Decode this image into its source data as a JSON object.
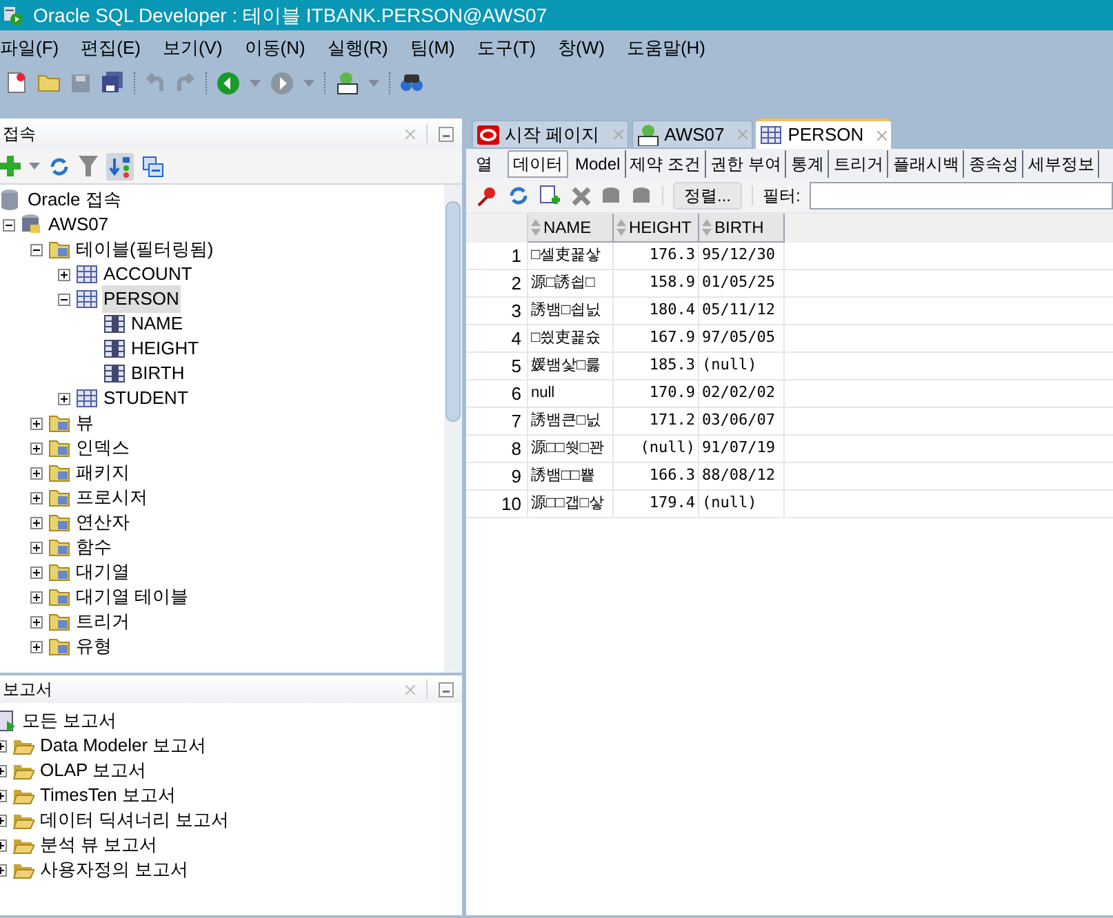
{
  "window": {
    "title": "Oracle SQL Developer : 테이블 ITBANK.PERSON@AWS07"
  },
  "menu": [
    "파일(F)",
    "편집(E)",
    "보기(V)",
    "이동(N)",
    "실행(R)",
    "팀(M)",
    "도구(T)",
    "창(W)",
    "도움말(H)"
  ],
  "connections_panel": {
    "title": "접속",
    "tree": [
      {
        "label": "Oracle 접속",
        "kind": "database",
        "selected": false,
        "children": [
          {
            "label": "AWS07",
            "kind": "connection",
            "expanded": true,
            "selected": false,
            "children": [
              {
                "label": "테이블(필터링됨)",
                "kind": "folder",
                "expanded": true,
                "selected": false,
                "children": [
                  {
                    "label": "ACCOUNT",
                    "kind": "table",
                    "expanded": false,
                    "selected": false
                  },
                  {
                    "label": "PERSON",
                    "kind": "table",
                    "expanded": true,
                    "selected": true,
                    "children": [
                      {
                        "label": "NAME",
                        "kind": "column",
                        "selected": false
                      },
                      {
                        "label": "HEIGHT",
                        "kind": "column",
                        "selected": false
                      },
                      {
                        "label": "BIRTH",
                        "kind": "column",
                        "selected": false
                      }
                    ]
                  },
                  {
                    "label": "STUDENT",
                    "kind": "table",
                    "expanded": false,
                    "selected": false
                  }
                ]
              },
              {
                "label": "뷰",
                "kind": "folder",
                "expanded": false,
                "selected": false
              },
              {
                "label": "인덱스",
                "kind": "folder",
                "expanded": false,
                "selected": false
              },
              {
                "label": "패키지",
                "kind": "folder",
                "expanded": false,
                "selected": false
              },
              {
                "label": "프로시저",
                "kind": "folder",
                "expanded": false,
                "selected": false
              },
              {
                "label": "연산자",
                "kind": "folder",
                "expanded": false,
                "selected": false
              },
              {
                "label": "함수",
                "kind": "folder",
                "expanded": false,
                "selected": false
              },
              {
                "label": "대기열",
                "kind": "folder",
                "expanded": false,
                "selected": false
              },
              {
                "label": "대기열 테이블",
                "kind": "folder",
                "expanded": false,
                "selected": false
              },
              {
                "label": "트리거",
                "kind": "folder",
                "expanded": false,
                "selected": false
              },
              {
                "label": "유형",
                "kind": "folder",
                "expanded": false,
                "selected": false
              }
            ]
          }
        ]
      }
    ]
  },
  "reports_panel": {
    "title": "보고서",
    "tree": [
      {
        "label": "모든 보고서",
        "kind": "report_root",
        "selected": false,
        "children": [
          {
            "label": "Data Modeler 보고서",
            "kind": "report_folder",
            "expanded": false,
            "selected": false
          },
          {
            "label": "OLAP 보고서",
            "kind": "report_folder",
            "expanded": false,
            "selected": false
          },
          {
            "label": "TimesTen 보고서",
            "kind": "report_folder",
            "expanded": false,
            "selected": false
          },
          {
            "label": "데이터 딕셔너리 보고서",
            "kind": "report_folder",
            "expanded": false,
            "selected": false
          },
          {
            "label": "분석 뷰 보고서",
            "kind": "report_folder",
            "expanded": false,
            "selected": false
          },
          {
            "label": "사용자정의 보고서",
            "kind": "report_folder",
            "expanded": false,
            "selected": false
          }
        ]
      }
    ]
  },
  "editor_tabs": [
    {
      "label": "시작 페이지",
      "kind": "start",
      "selected": false
    },
    {
      "label": "AWS07",
      "kind": "sql",
      "selected": false
    },
    {
      "label": "PERSON",
      "kind": "table",
      "selected": true
    }
  ],
  "sub_tabs": [
    {
      "label": "열",
      "selected": false
    },
    {
      "label": "데이터",
      "selected": true
    },
    {
      "label": "Model",
      "selected": false
    },
    {
      "label": "제약 조건",
      "selected": false
    },
    {
      "label": "권한 부여",
      "selected": false
    },
    {
      "label": "통계",
      "selected": false
    },
    {
      "label": "트리거",
      "selected": false
    },
    {
      "label": "플래시백",
      "selected": false
    },
    {
      "label": "종속성",
      "selected": false
    },
    {
      "label": "세부정보",
      "selected": false
    }
  ],
  "data_toolbar": {
    "sort_button": "정렬...",
    "filter_label": "필터:"
  },
  "grid": {
    "columns": [
      "",
      "NAME",
      "HEIGHT",
      "BIRTH"
    ],
    "rows": [
      [
        "1",
        "□셀吏꾩샇",
        "176.3",
        "95/12/30"
      ],
      [
        "2",
        "源□誘쇱□",
        "158.9",
        "01/05/25"
      ],
      [
        "3",
        "誘뱀□쇱닔",
        "180.4",
        "05/11/12"
      ],
      [
        "4",
        "□씠吏꾩슜",
        "167.9",
        "97/05/05"
      ],
      [
        "5",
        "媛뱀샃□룷",
        "185.3",
        "(null)"
      ],
      [
        "6",
        "null",
        "170.9",
        "02/02/02"
      ],
      [
        "7",
        "誘뱀큰□닔",
        "171.2",
        "03/06/07"
      ],
      [
        "8",
        "源□□쒓□꽌",
        "(null)",
        "91/07/19"
      ],
      [
        "9",
        "誘뱀□□뿉",
        "166.3",
        "88/08/12"
      ],
      [
        "10",
        "源□□갭□샇",
        "179.4",
        "(null)"
      ]
    ]
  }
}
